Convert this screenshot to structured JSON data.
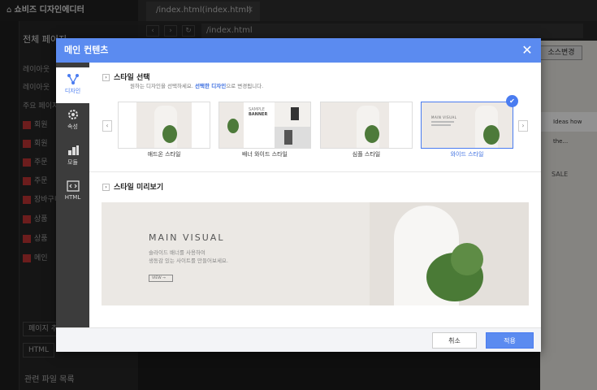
{
  "editor": {
    "app_title": "쇼비즈 디자인에디터",
    "tab_name": "/index.html(index.html)",
    "url": "/index.html",
    "source_button": "소스변경",
    "sidebar_header": "전체 페이지",
    "sidebar_rows": [
      "레이아웃",
      "레이아웃",
      "주요 페이지",
      "회원",
      "회원",
      "주문",
      "주문",
      "장바구니",
      "상품",
      "상품",
      "메인"
    ],
    "page_button": "페이지 추가",
    "html_button": "HTML",
    "related_files": "관련 파일 목록",
    "strip_text": "Ideas how the...",
    "sale_label": "SALE"
  },
  "modal": {
    "title": "메인 컨텐츠",
    "close_glyph": "✕",
    "sidebar": [
      {
        "label": "디자인",
        "icon": "design-icon",
        "active": true
      },
      {
        "label": "속성",
        "icon": "gear-icon",
        "active": false
      },
      {
        "label": "모듈",
        "icon": "module-icon",
        "active": false
      },
      {
        "label": "HTML",
        "icon": "html-icon",
        "active": false
      }
    ],
    "style_select": {
      "title": "스타일 선택",
      "desc_prefix": "원하는 디자인을 선택하세요.",
      "desc_bold": "선택한 디자인",
      "desc_suffix": "으로 변경됩니다.",
      "cards": [
        {
          "label": "애드온 스타일",
          "selected": false
        },
        {
          "label": "배너 와이드 스타일",
          "selected": false,
          "banner_title": "SAMPLE",
          "banner_sub": "BANNER"
        },
        {
          "label": "심플 스타일",
          "selected": false
        },
        {
          "label": "와이드 스타일",
          "selected": true,
          "thumb_title": "MAIN VISUAL"
        }
      ],
      "prev_glyph": "‹",
      "next_glyph": "›",
      "check_glyph": "✔"
    },
    "preview": {
      "title": "스타일 미리보기",
      "visual_title": "MAIN VISUAL",
      "visual_text_1": "슬라이드 배너를 사용하여",
      "visual_text_2": "생동감 있는 사이트를 만들어보세요.",
      "visual_button": "VIEW →"
    },
    "footer": {
      "cancel": "취소",
      "apply": "적용"
    }
  }
}
